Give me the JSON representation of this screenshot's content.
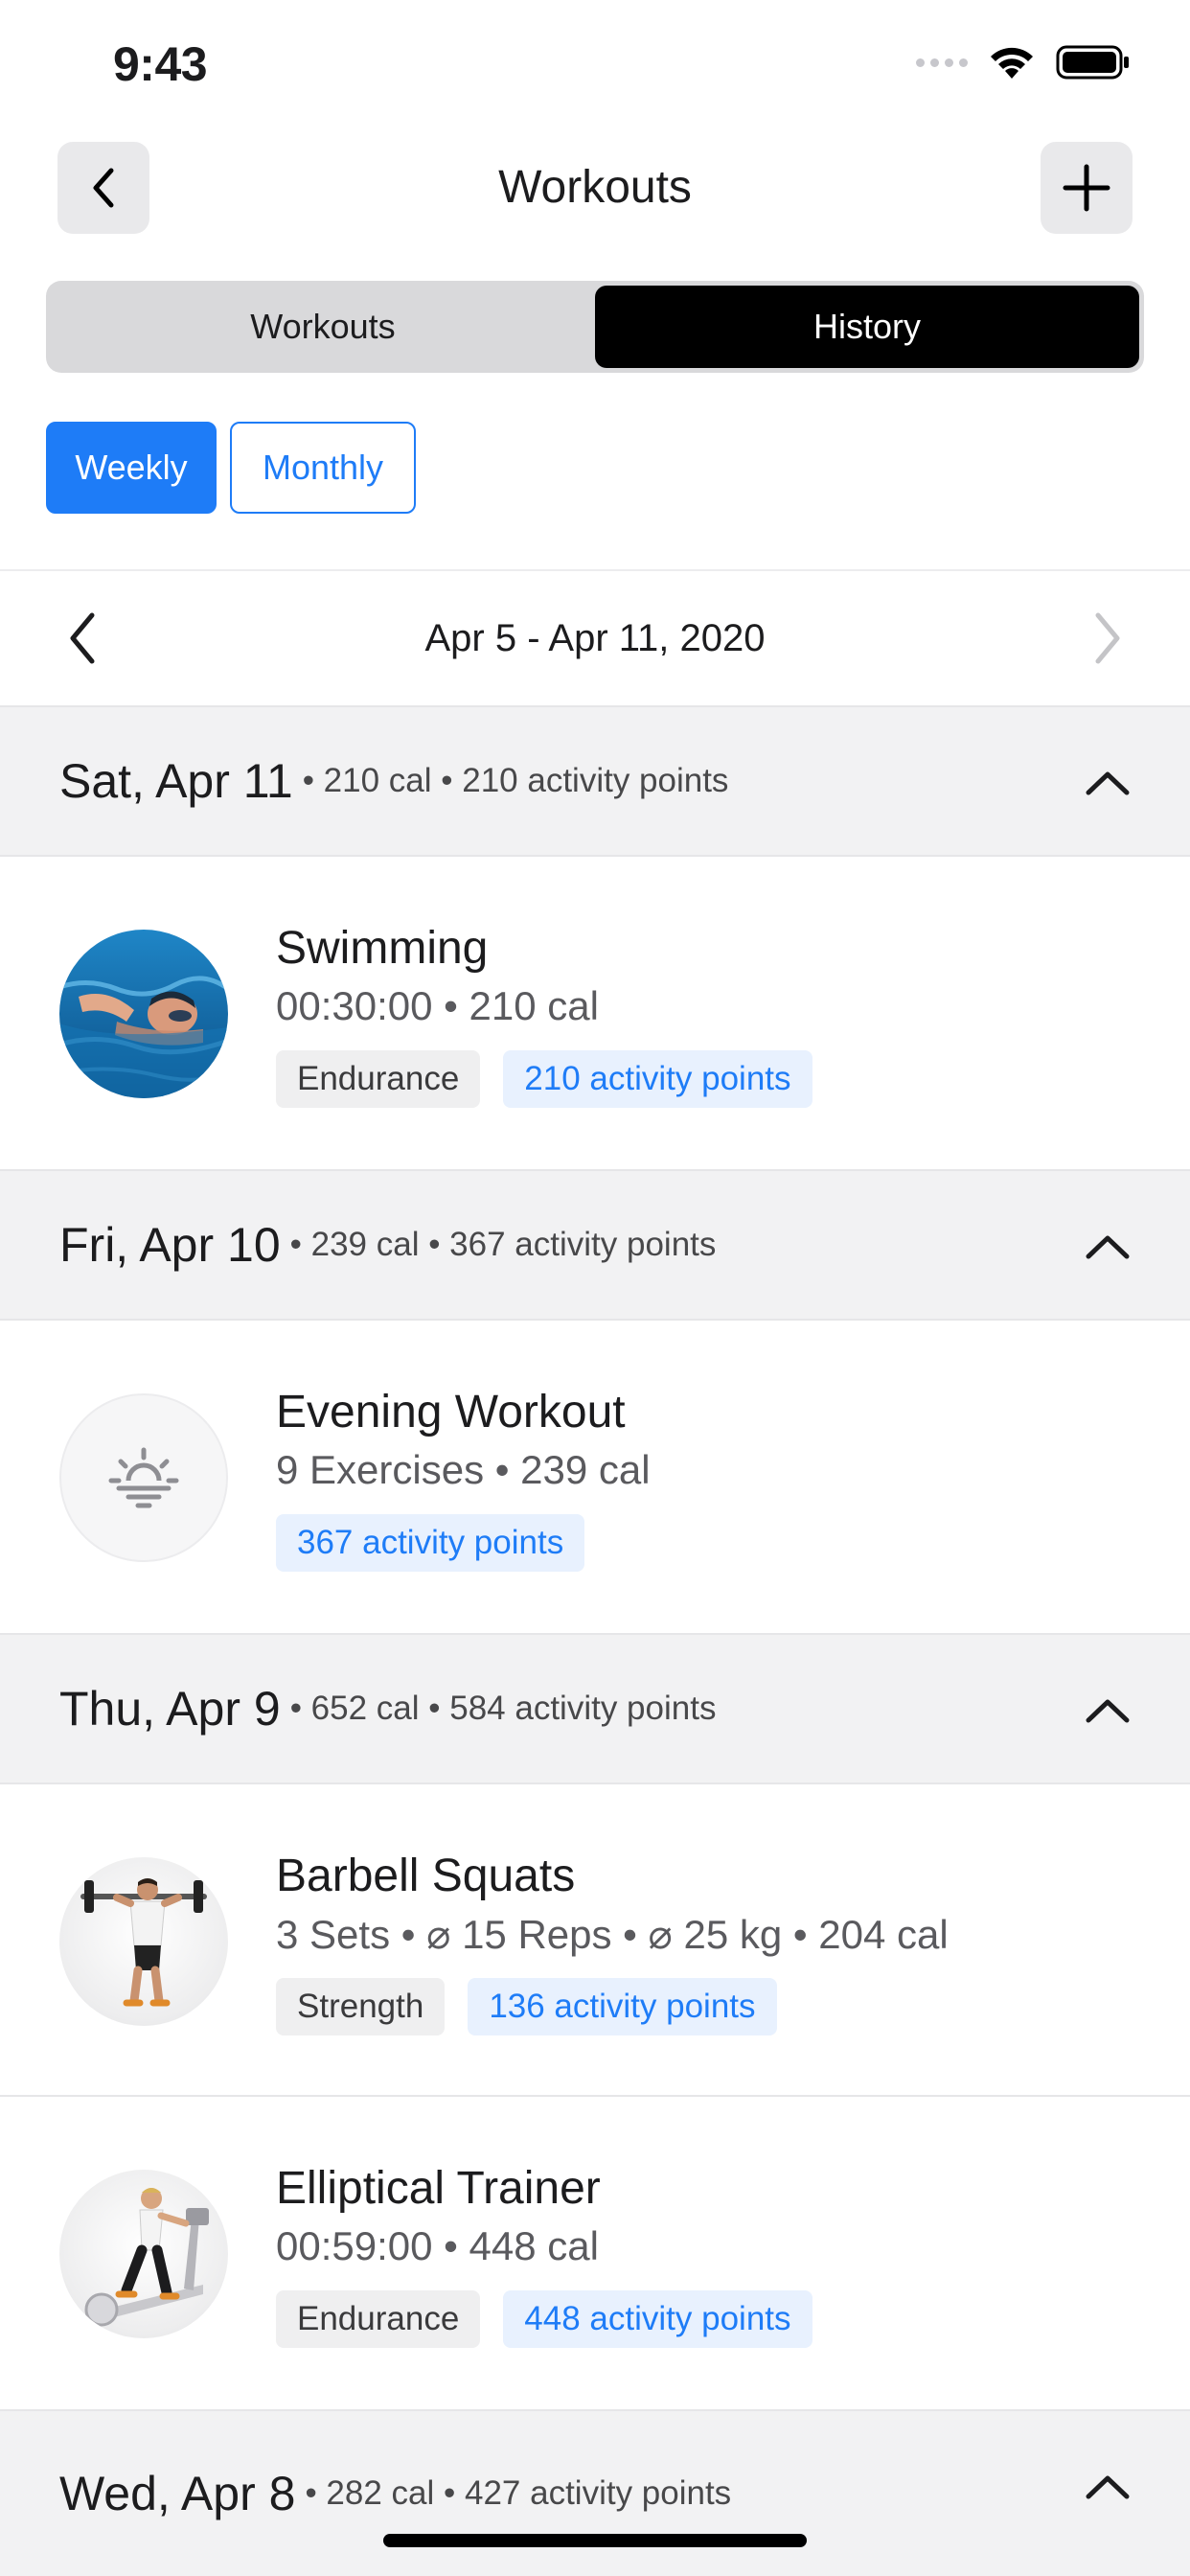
{
  "status_bar": {
    "time": "9:43"
  },
  "nav": {
    "title": "Workouts",
    "back_icon": "chevron-left-icon",
    "add_icon": "plus-icon"
  },
  "tabs": [
    {
      "label": "Workouts",
      "active": false
    },
    {
      "label": "History",
      "active": true
    }
  ],
  "period": {
    "weekly": "Weekly",
    "monthly": "Monthly",
    "selected": "Weekly"
  },
  "date_nav": {
    "range": "Apr 5 - Apr 11, 2020"
  },
  "days": [
    {
      "title": "Sat, Apr 11",
      "summary": "• 210 cal • 210 activity points",
      "workouts": [
        {
          "name": "Swimming",
          "detail": "00:30:00 • 210 cal",
          "category": "Endurance",
          "points": "210 activity points",
          "icon": "swimming-photo"
        }
      ]
    },
    {
      "title": "Fri, Apr 10",
      "summary": "• 239 cal • 367 activity points",
      "workouts": [
        {
          "name": "Evening Workout",
          "detail": "9 Exercises • 239 cal",
          "category": "",
          "points": "367 activity points",
          "icon": "sunset-icon"
        }
      ]
    },
    {
      "title": "Thu, Apr 9",
      "summary": "• 652 cal • 584 activity points",
      "workouts": [
        {
          "name": "Barbell Squats",
          "detail": "3 Sets • ⌀ 15 Reps • ⌀ 25 kg • 204 cal",
          "category": "Strength",
          "points": "136 activity points",
          "icon": "barbell-squat-figure"
        },
        {
          "name": "Elliptical Trainer",
          "detail": "00:59:00 • 448 cal",
          "category": "Endurance",
          "points": "448 activity points",
          "icon": "elliptical-figure"
        }
      ]
    },
    {
      "title": "Wed, Apr 8",
      "summary": "• 282 cal • 427 activity points",
      "workouts": []
    }
  ],
  "colors": {
    "accent": "#1e7cf7",
    "tag_blue_bg": "#e8f1fe",
    "section_bg": "#f2f2f3",
    "segment_active": "#000000"
  }
}
